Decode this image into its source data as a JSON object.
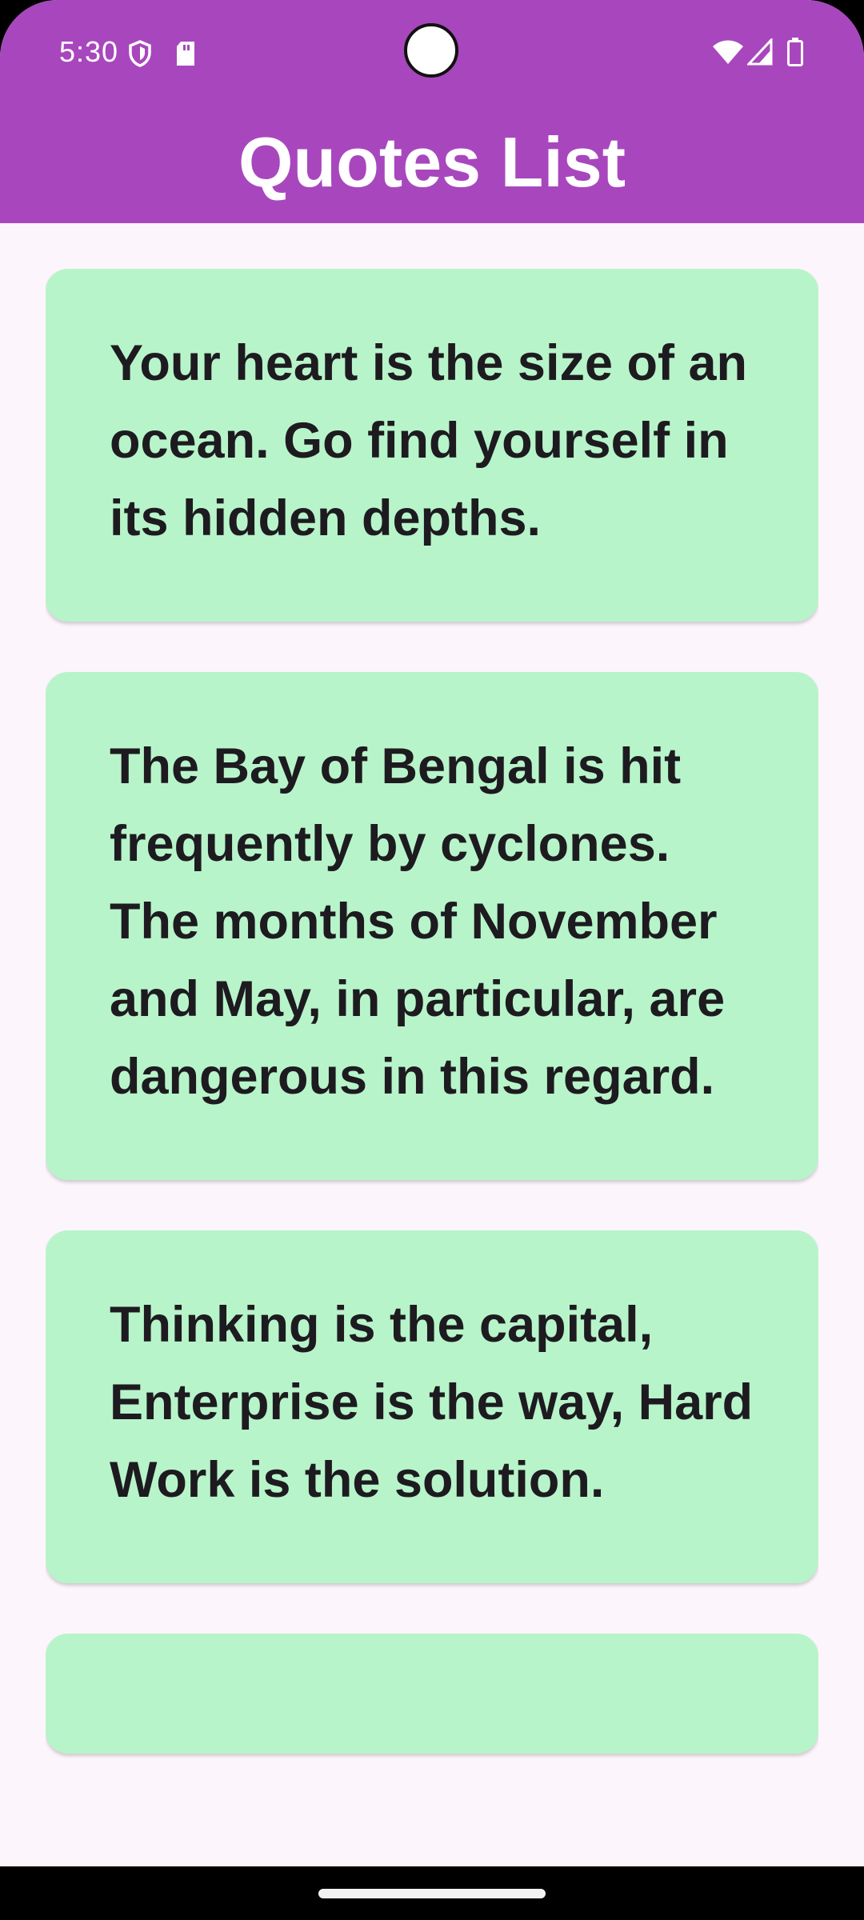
{
  "status_bar": {
    "time": "5:30",
    "icons": [
      "shield-icon",
      "sd-card-icon",
      "wifi-icon",
      "cellular-signal-icon",
      "battery-icon"
    ]
  },
  "app_bar": {
    "title": "Quotes List",
    "color": "#a847bd"
  },
  "quotes": [
    {
      "text": "Your heart is the size of an ocean. Go find yourself in its hidden depths."
    },
    {
      "text": "The Bay of Bengal is hit frequently by cyclones. The months of November and May, in particular, are dangerous in this regard."
    },
    {
      "text": "Thinking is the capital, Enterprise is the way, Hard Work is the solution."
    },
    {
      "text": ""
    }
  ],
  "colors": {
    "card_background": "#b8f4ca",
    "page_background": "#fcf5fc",
    "text": "#1d1b20"
  }
}
